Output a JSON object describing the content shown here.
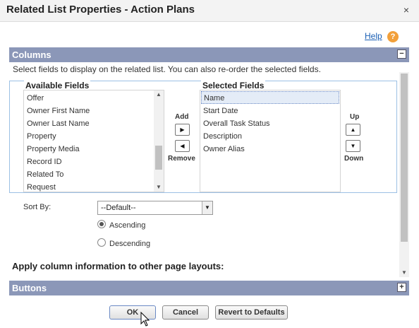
{
  "dialog": {
    "title": "Related List Properties - Action Plans",
    "close_glyph": "×"
  },
  "help": {
    "link_label": "Help",
    "icon_glyph": "?"
  },
  "columns_section": {
    "title": "Columns",
    "toggle_glyph": "−",
    "instructions": "Select fields to display on the related list. You can also re-order the selected fields."
  },
  "available_fields": {
    "legend": "Available Fields",
    "items": [
      "Offer",
      "Owner First Name",
      "Owner Last Name",
      "Property",
      "Property Media",
      "Record ID",
      "Related To",
      "Request"
    ]
  },
  "mover": {
    "add_label": "Add",
    "remove_label": "Remove",
    "up_label": "Up",
    "down_label": "Down"
  },
  "selected_fields": {
    "legend": "Selected Fields",
    "items": [
      "Name",
      "Start Date",
      "Overall Task Status",
      "Description",
      "Owner Alias"
    ],
    "selected_item": "Name"
  },
  "sort": {
    "label": "Sort By:",
    "value": "--Default--",
    "ascending_label": "Ascending",
    "descending_label": "Descending",
    "selected_order": "Ascending"
  },
  "apply_heading": "Apply column information to other page layouts:",
  "buttons_section": {
    "title": "Buttons",
    "toggle_glyph": "+"
  },
  "footer": {
    "ok_label": "OK",
    "cancel_label": "Cancel",
    "reset_label": "Revert to Defaults"
  },
  "colors": {
    "section_header": "#8b97b8",
    "link": "#1a5fb4",
    "help_icon": "#f2a03a",
    "panel_border": "#9cc0e4"
  }
}
